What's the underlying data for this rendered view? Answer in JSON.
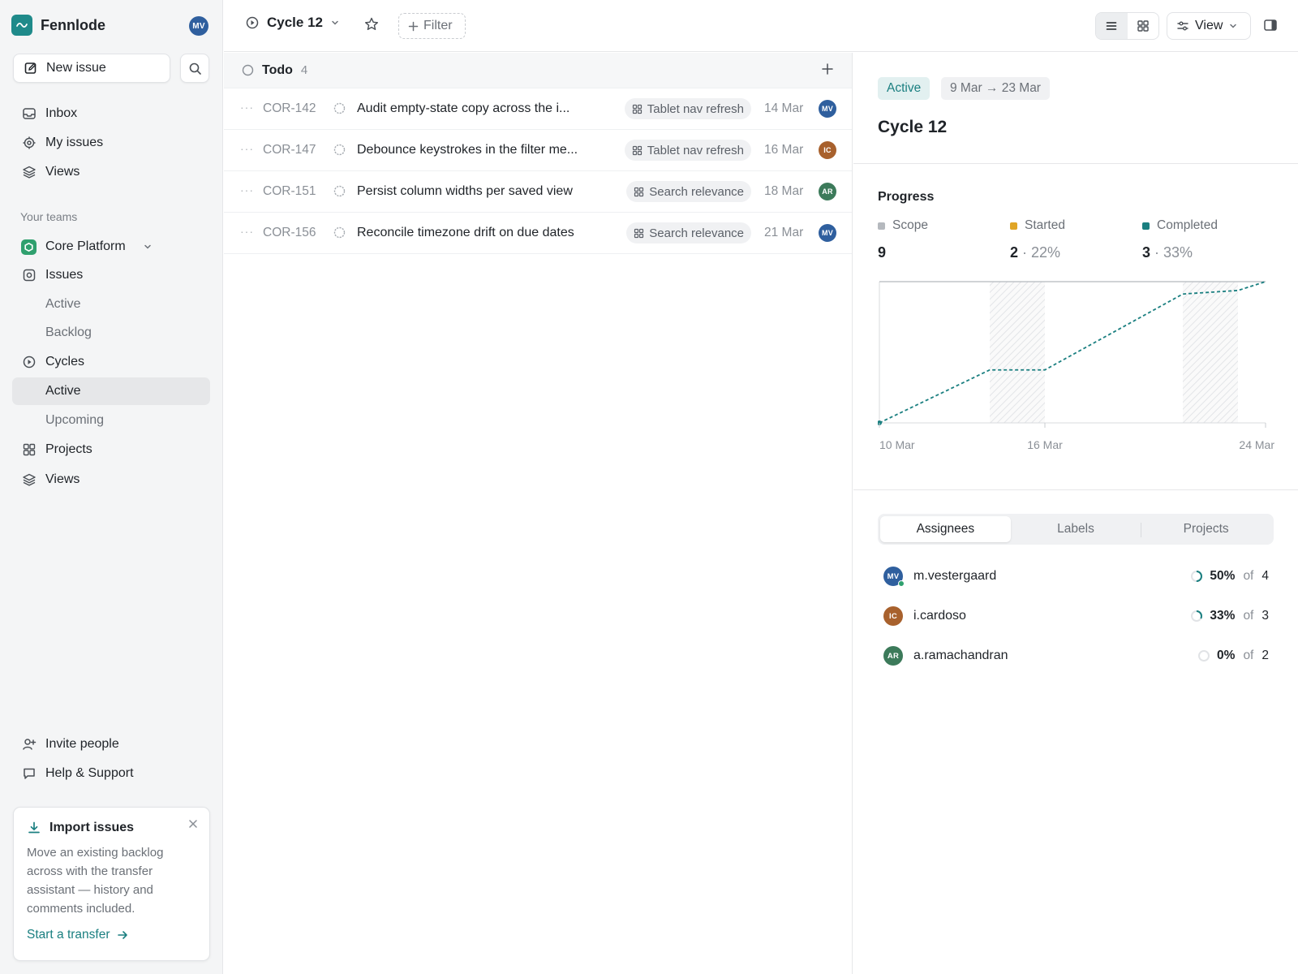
{
  "app": {
    "name": "Fennlode",
    "user_initials": "MV",
    "accent_color": "#1a7f80"
  },
  "sidebar": {
    "new_issue_label": "New issue",
    "top_nav": [
      {
        "label": "Inbox",
        "icon": "inbox-icon"
      },
      {
        "label": "My issues",
        "icon": "target-icon"
      },
      {
        "label": "Views",
        "icon": "layers-icon"
      }
    ],
    "section_label": "Your teams",
    "team": {
      "name": "Core Platform",
      "items": [
        {
          "label": "Issues",
          "icon": "issues-icon"
        },
        {
          "label": "Active",
          "sub": true
        },
        {
          "label": "Backlog",
          "sub": true
        },
        {
          "label": "Cycles",
          "icon": "cycle-icon"
        },
        {
          "label": "Active",
          "sub": true,
          "selected": true
        },
        {
          "label": "Upcoming",
          "sub": true
        },
        {
          "label": "Projects",
          "icon": "projects-icon"
        },
        {
          "label": "Views",
          "icon": "layers-icon"
        }
      ]
    },
    "bottom_nav": [
      {
        "label": "Invite people",
        "icon": "invite-icon"
      },
      {
        "label": "Help & Support",
        "icon": "chat-icon"
      }
    ],
    "promo": {
      "title": "Import issues",
      "body": "Move an existing backlog across with the transfer assistant — history and comments included.",
      "link": "Start a transfer"
    }
  },
  "topbar": {
    "cycle_name": "Cycle 12",
    "filter_label": "Filter",
    "view_label": "View"
  },
  "issue_group": {
    "title": "Todo",
    "count": "4",
    "issues": [
      {
        "id": "COR-142",
        "title": "Audit empty-state copy across the i...",
        "label": "Tablet nav refresh",
        "date": "14 Mar",
        "assignee": "MV",
        "assignee_color": "#2f5f9e"
      },
      {
        "id": "COR-147",
        "title": "Debounce keystrokes in the filter me...",
        "label": "Tablet nav refresh",
        "date": "16 Mar",
        "assignee": "IC",
        "assignee_color": "#a8612d"
      },
      {
        "id": "COR-151",
        "title": "Persist column widths per saved view",
        "label": "Search relevance",
        "date": "18 Mar",
        "assignee": "AR",
        "assignee_color": "#3c7a5a"
      },
      {
        "id": "COR-156",
        "title": "Reconcile timezone drift on due dates",
        "label": "Search relevance",
        "date": "21 Mar",
        "assignee": "MV",
        "assignee_color": "#2f5f9e"
      }
    ]
  },
  "details": {
    "status_chip": "Active",
    "date_range": "9 Mar → 23 Mar",
    "title": "Cycle 12",
    "progress_title": "Progress",
    "stats": [
      {
        "label": "Scope",
        "value": "9",
        "pct": "",
        "color": "#b5b9be"
      },
      {
        "label": "Started",
        "value": "2",
        "pct": "· 22%",
        "color": "#e0a526"
      },
      {
        "label": "Completed",
        "value": "3",
        "pct": "· 33%",
        "color": "#1a7f80"
      }
    ],
    "tabs": [
      "Assignees",
      "Labels",
      "Projects"
    ],
    "assignees": [
      {
        "initials": "MV",
        "name": "m.vestergaard",
        "pct": "50%",
        "of": "of",
        "total": "4",
        "color": "#2f5f9e",
        "fraction": 0.5,
        "online": true
      },
      {
        "initials": "IC",
        "name": "i.cardoso",
        "pct": "33%",
        "of": "of",
        "total": "3",
        "color": "#a8612d",
        "fraction": 0.33,
        "online": false
      },
      {
        "initials": "AR",
        "name": "a.ramachandran",
        "pct": "0%",
        "of": "of",
        "total": "2",
        "color": "#3c7a5a",
        "fraction": 0,
        "online": false
      }
    ]
  },
  "chart_data": {
    "type": "line",
    "title": "",
    "x_ticks": [
      "10 Mar",
      "16 Mar",
      "24 Mar"
    ],
    "x_range": [
      "10 Mar",
      "24 Mar"
    ],
    "series": [
      {
        "values_x": [
          "10 Mar",
          "14 Mar",
          "16 Mar",
          "21 Mar",
          "23 Mar",
          "24 Mar"
        ],
        "values": [
          0,
          3.0,
          3.0,
          7.3,
          7.5,
          8.0
        ],
        "style": "dashed",
        "color": "#1a7f80"
      }
    ],
    "scope_line": 8.0,
    "weekend_bands": [
      [
        "14 Mar",
        "16 Mar"
      ],
      [
        "21 Mar",
        "23 Mar"
      ]
    ],
    "ylim": [
      0,
      8
    ]
  }
}
